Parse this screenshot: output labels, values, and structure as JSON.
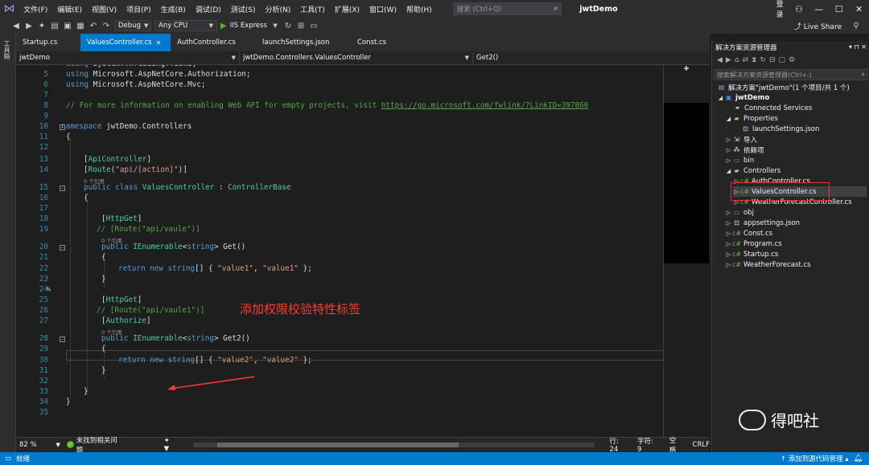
{
  "menu": {
    "items": [
      "文件(F)",
      "编辑(E)",
      "视图(V)",
      "项目(P)",
      "生成(B)",
      "调试(D)",
      "测试(S)",
      "分析(N)",
      "工具(T)",
      "扩展(X)",
      "窗口(W)",
      "帮助(H)"
    ],
    "search_placeholder": "搜索 (Ctrl+Q)",
    "project_name": "jwtDemo",
    "login": "登录"
  },
  "toolbar": {
    "config": "Debug",
    "platform": "Any CPU",
    "run_label": "IIS Express",
    "live_share": "Live Share"
  },
  "left_strip_label": "工具箱",
  "tabs": [
    {
      "label": "Startup.cs",
      "active": false
    },
    {
      "label": "ValuesController.cs",
      "active": true
    },
    {
      "label": "AuthController.cs",
      "active": false
    },
    {
      "label": "launchSettings.json",
      "active": false
    },
    {
      "label": "Const.cs",
      "active": false
    }
  ],
  "navbar": {
    "project": "jwtDemo",
    "class": "jwtDemo.Controllers.ValuesController",
    "member": "Get2()"
  },
  "code_lines": [
    {
      "n": "4",
      "t": "using System.Threading.Tasks;"
    },
    {
      "n": "5",
      "t": "using Microsoft.AspNetCore.Authorization;"
    },
    {
      "n": "6",
      "t": "using Microsoft.AspNetCore.Mvc;"
    },
    {
      "n": "7",
      "t": ""
    },
    {
      "n": "8",
      "t": "// For more information on enabling Web API for empty projects, visit https://go.microsoft.com/fwlink/?LinkID=397860"
    },
    {
      "n": "9",
      "t": ""
    },
    {
      "n": "10",
      "t": "namespace jwtDemo.Controllers"
    },
    {
      "n": "11",
      "t": "{"
    },
    {
      "n": "12",
      "t": ""
    },
    {
      "n": "13",
      "t": "[ApiController]"
    },
    {
      "n": "14",
      "t": "[Route(\"api/[action]\")]"
    },
    {
      "n": "15",
      "t": "public class ValuesController : ControllerBase"
    },
    {
      "n": "16",
      "t": "{"
    },
    {
      "n": "17",
      "t": ""
    },
    {
      "n": "18",
      "t": "[HttpGet]"
    },
    {
      "n": "19",
      "t": "// [Route(\"api/vaule\")]"
    },
    {
      "n": "20",
      "t": "public IEnumerable<string> Get()"
    },
    {
      "n": "21",
      "t": "{"
    },
    {
      "n": "22",
      "t": "return new string[] { \"value1\", \"value1\" };"
    },
    {
      "n": "23",
      "t": "}"
    },
    {
      "n": "24",
      "t": ""
    },
    {
      "n": "25",
      "t": "[HttpGet]"
    },
    {
      "n": "26",
      "t": "// [Route(\"api/vaule1\")]"
    },
    {
      "n": "27",
      "t": "[Authorize]"
    },
    {
      "n": "28",
      "t": "public IEnumerable<string> Get2()"
    },
    {
      "n": "29",
      "t": "{"
    },
    {
      "n": "30",
      "t": "return new string[] { \"value2\", \"value2\" };"
    },
    {
      "n": "31",
      "t": "}"
    },
    {
      "n": "32",
      "t": ""
    },
    {
      "n": "33",
      "t": "}"
    },
    {
      "n": "34",
      "t": "}"
    },
    {
      "n": "35",
      "t": ""
    }
  ],
  "codelens": "0 个引用",
  "annotation": "添加权限校验特性标签",
  "editor_status": {
    "zoom": "82 %",
    "issues": "未找到相关问题",
    "line": "行: 24",
    "col": "字符: 9",
    "ws": "空格",
    "eol": "CRLF"
  },
  "solution": {
    "title": "解决方案资源管理器",
    "search_placeholder": "搜索解决方案资源管理器(Ctrl+;)",
    "items": [
      {
        "label": "解决方案\"jwtDemo\"(1 个项目/共 1 个)",
        "icon": "solution-icon"
      },
      {
        "label": "jwtDemo",
        "icon": "project-icon"
      },
      {
        "label": "Connected Services",
        "icon": "connected-services-icon"
      },
      {
        "label": "Properties",
        "icon": "folder-icon"
      },
      {
        "label": "launchSettings.json",
        "icon": "json-file-icon"
      },
      {
        "label": "导入",
        "icon": "import-icon"
      },
      {
        "label": "依赖项",
        "icon": "dependencies-icon"
      },
      {
        "label": "bin",
        "icon": "folder-icon"
      },
      {
        "label": "Controllers",
        "icon": "folder-icon"
      },
      {
        "label": "AuthController.cs",
        "icon": "csharp-file-icon"
      },
      {
        "label": "ValuesController.cs",
        "icon": "csharp-file-icon"
      },
      {
        "label": "WeatherForecastController.cs",
        "icon": "csharp-file-icon"
      },
      {
        "label": "obj",
        "icon": "folder-icon"
      },
      {
        "label": "appsettings.json",
        "icon": "json-file-icon"
      },
      {
        "label": "Const.cs",
        "icon": "csharp-file-icon"
      },
      {
        "label": "Program.cs",
        "icon": "csharp-file-icon"
      },
      {
        "label": "Startup.cs",
        "icon": "csharp-file-icon"
      },
      {
        "label": "WeatherForecast.cs",
        "icon": "csharp-file-icon"
      }
    ]
  },
  "watermark": "得吧社",
  "statusbar": {
    "ready": "就绪",
    "source_control": "添加到源代码管理"
  }
}
